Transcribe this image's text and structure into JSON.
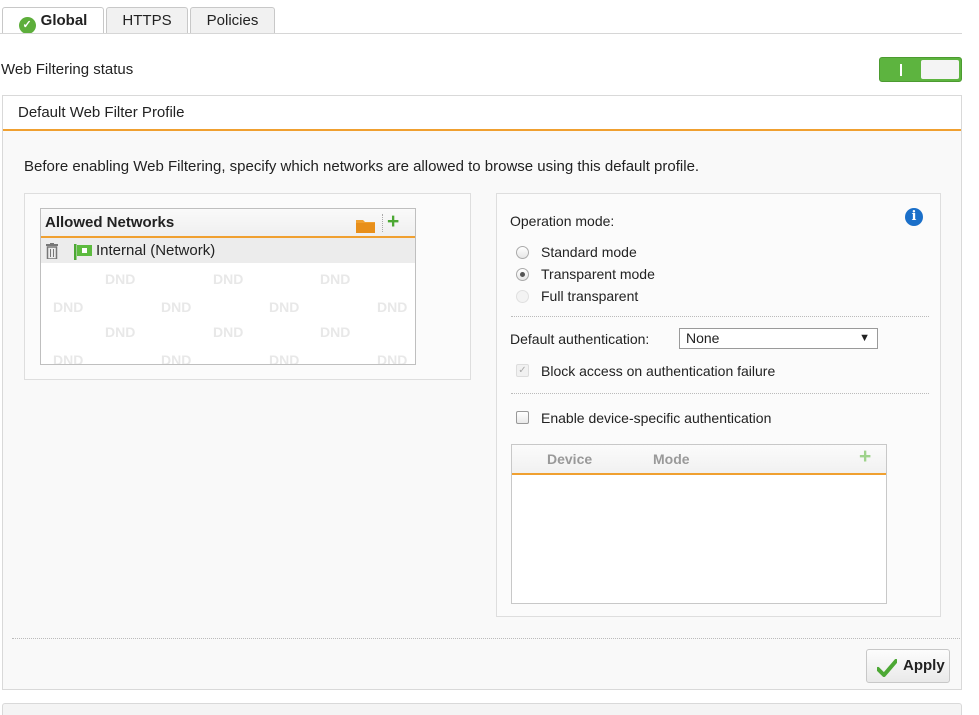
{
  "tabs": [
    {
      "label": "Global",
      "active": true
    },
    {
      "label": "HTTPS",
      "active": false
    },
    {
      "label": "Policies",
      "active": false
    }
  ],
  "web_filtering_status": {
    "label": "Web Filtering status",
    "enabled": true
  },
  "profile": {
    "title": "Default Web Filter Profile",
    "description": "Before enabling Web Filtering, specify which networks are allowed to browse using this default profile."
  },
  "allowed_networks": {
    "title": "Allowed Networks",
    "items": [
      {
        "label": "Internal (Network)"
      }
    ],
    "watermark": "DND"
  },
  "operation_mode": {
    "label": "Operation mode:",
    "options": [
      {
        "label": "Standard mode",
        "selected": false,
        "disabled": false
      },
      {
        "label": "Transparent mode",
        "selected": true,
        "disabled": false
      },
      {
        "label": "Full transparent",
        "selected": false,
        "disabled": true
      }
    ]
  },
  "default_authentication": {
    "label": "Default authentication:",
    "value": "None"
  },
  "block_access": {
    "label": "Block access on authentication failure",
    "checked": true,
    "disabled": true
  },
  "device_auth": {
    "label": "Enable device-specific authentication",
    "checked": false
  },
  "device_table": {
    "columns": [
      "Device",
      "Mode"
    ]
  },
  "apply": {
    "label": "Apply"
  },
  "colors": {
    "accent": "#f0a030",
    "toggle_on": "#5db43f",
    "info": "#1a6fc9"
  }
}
